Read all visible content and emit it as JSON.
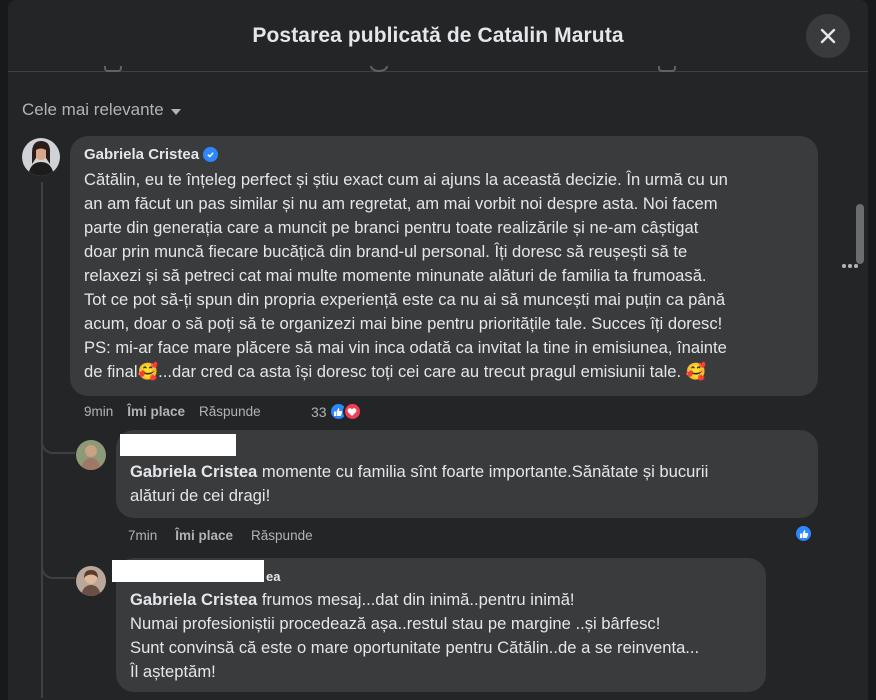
{
  "header": {
    "title": "Postarea publicată de Catalin Maruta"
  },
  "sort": {
    "label": "Cele mai relevante"
  },
  "comments": [
    {
      "author": "Gabriela Cristea",
      "lines": [
        "Cătălin, eu te înțeleg perfect și știu exact cum ai ajuns la această decizie. În urmă cu un",
        "an am făcut un pas similar și nu am regretat, am mai vorbit noi despre asta. Noi facem",
        "parte din generația care a muncit pe branci pentru toate realizările și ne-am câștigat",
        "doar prin muncă fiecare bucățică din brand-ul personal. Îți doresc să reușești să te",
        "relaxezi și să petreci cat mai multe momente minunate alături de familia ta frumoasă.",
        "Tot ce pot să-ți spun din propria experiență este ca nu ai să muncești mai puțin ca până",
        "acum, doar o să poți să te organizezi mai bine pentru prioritățile tale. Succes îți doresc!",
        "PS: mi-ar face mare plăcere să mai vin inca odată ca invitat la tine in emisiunea, înainte",
        "de final🥰...dar cred ca asta își doresc toți cei care au trecut pragul emisiunii tale. 🥰"
      ],
      "time": "9min",
      "like_label": "Îmi place",
      "reply_label": "Răspunde",
      "reaction_count": "33"
    }
  ],
  "replies": [
    {
      "mention": "Gabriela Cristea",
      "lines": [
        " momente cu familia sînt foarte importante.Sănătate și bucurii",
        "alături de cei dragi!"
      ],
      "time": "7min",
      "like_label": "Îmi place",
      "reply_label": "Răspunde"
    },
    {
      "author_suffix": "ea",
      "mention": "Gabriela Cristea",
      "lines": [
        " frumos mesaj...dat din inimă..pentru inimă!",
        "Numai profesioniștii procedează așa..restul stau pe margine ..și bârfesc!",
        "Sunt convinsă că este o mare oportunitate pentru Cătălin..de a se reinventa...",
        "Îl așteptăm!"
      ]
    }
  ],
  "icons": {
    "close": "close-icon",
    "verified": "verified-badge-icon",
    "like": "like-reaction-icon",
    "love": "love-reaction-icon",
    "more": "more-options-icon",
    "sort_caret": "caret-down-icon"
  },
  "colors": {
    "background": "#242526",
    "bubble": "#3a3b3c",
    "text": "#e4e6eb",
    "secondary_text": "#b0b3b8",
    "like_blue": "#2d88ff",
    "love_red": "#f33e58"
  }
}
